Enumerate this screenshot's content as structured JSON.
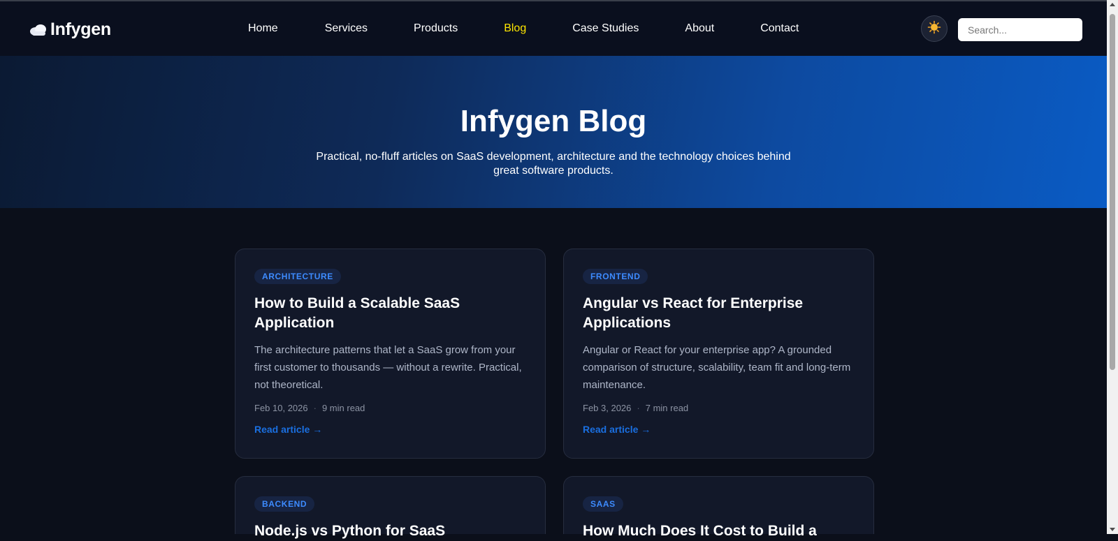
{
  "brand": {
    "name": "Infygen",
    "icon": "cloud-icon"
  },
  "nav": {
    "items": [
      {
        "label": "Home",
        "active": false
      },
      {
        "label": "Services",
        "active": false
      },
      {
        "label": "Products",
        "active": false
      },
      {
        "label": "Blog",
        "active": true
      },
      {
        "label": "Case Studies",
        "active": false
      },
      {
        "label": "About",
        "active": false
      },
      {
        "label": "Contact",
        "active": false
      }
    ],
    "theme_toggle_icon": "sun-icon",
    "search": {
      "placeholder": "Search...",
      "value": ""
    }
  },
  "hero": {
    "title": "Infygen Blog",
    "subtitle": "Practical, no-fluff articles on SaaS development, architecture and the technology choices behind great software products."
  },
  "posts": [
    {
      "category": "ARCHITECTURE",
      "title": "How to Build a Scalable SaaS Application",
      "description": "The architecture patterns that let a SaaS grow from your first customer to thousands — without a rewrite. Practical, not theoretical.",
      "date": "Feb 10, 2026",
      "read_time": "9 min read",
      "link_label": "Read article →"
    },
    {
      "category": "FRONTEND",
      "title": "Angular vs React for Enterprise Applications",
      "description": "Angular or React for your enterprise app? A grounded comparison of structure, scalability, team fit and long-term maintenance.",
      "date": "Feb 3, 2026",
      "read_time": "7 min read",
      "link_label": "Read article →"
    },
    {
      "category": "BACKEND",
      "title": "Node.js vs Python for SaaS"
    },
    {
      "category": "SAAS",
      "title": "How Much Does It Cost to Build a"
    }
  ],
  "colors": {
    "nav_background": "#0a0f1e",
    "active_nav": "#ffe600",
    "accent_blue": "#3d8bff",
    "link_blue": "#1a6fe0",
    "card_background": "#121829",
    "page_background": "#0b0f1a"
  }
}
